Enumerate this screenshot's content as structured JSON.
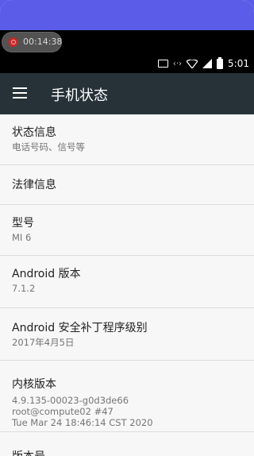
{
  "recording": {
    "time": "00:14:38"
  },
  "status_bar": {
    "time": "5:01",
    "data_label": "‹·›",
    "colors": {
      "bg": "#000000",
      "fg": "#ffffff"
    }
  },
  "app_bar": {
    "title": "手机状态",
    "bg": "#263238"
  },
  "items": [
    {
      "title": "状态信息",
      "sub": "电话号码、信号等"
    },
    {
      "title": "法律信息"
    },
    {
      "title": "型号",
      "sub": "MI 6"
    },
    {
      "title": "Android 版本",
      "sub": "7.1.2"
    },
    {
      "title": "Android 安全补丁程序级别",
      "sub": "2017年4月5日"
    },
    {
      "title": "内核版本",
      "sub_lines": [
        "4.9.135-00023-g0d3de66",
        "root@compute02 #47",
        "Tue Mar 24 18:46:14 CST 2020"
      ]
    },
    {
      "title": "版本号"
    }
  ]
}
